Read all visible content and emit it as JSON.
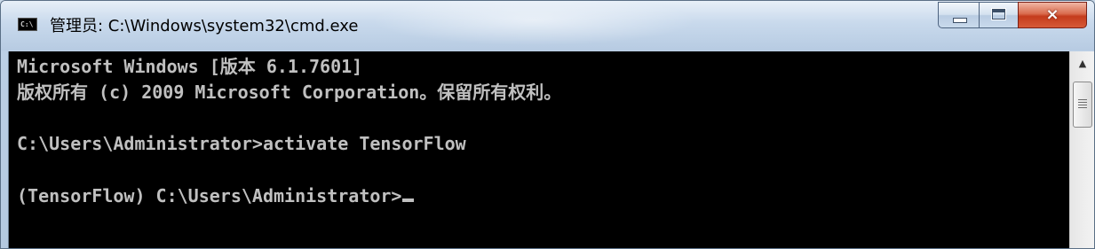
{
  "window": {
    "title": "管理员: C:\\Windows\\system32\\cmd.exe",
    "app_icon_label": "C:\\",
    "buttons": {
      "minimize": "minimize",
      "maximize": "maximize",
      "close": "×"
    }
  },
  "console": {
    "lines": [
      "Microsoft Windows [版本 6.1.7601]",
      "版权所有 (c) 2009 Microsoft Corporation。保留所有权利。",
      "",
      "C:\\Users\\Administrator>activate TensorFlow",
      "",
      "(TensorFlow) C:\\Users\\Administrator>"
    ]
  },
  "scrollbar": {
    "up_arrow": "▲"
  },
  "colors": {
    "console_bg": "#000000",
    "console_text": "#c0c0c0",
    "close_button": "#c43b1c"
  },
  "icons": {
    "app": "cmd-icon",
    "minimize": "minimize-icon",
    "maximize": "maximize-icon",
    "close": "close-icon",
    "scroll_up": "chevron-up-icon"
  }
}
